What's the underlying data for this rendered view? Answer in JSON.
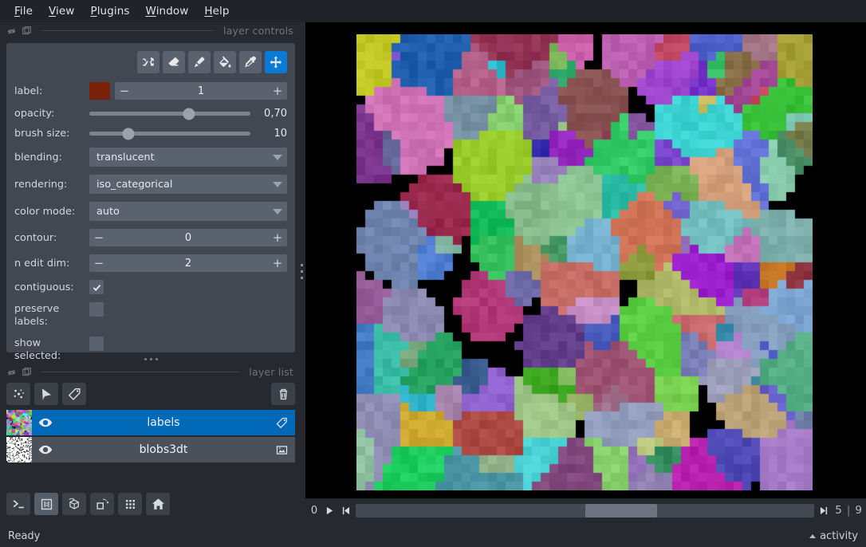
{
  "menu": {
    "items": [
      {
        "label": "File",
        "mnemonic": "F"
      },
      {
        "label": "View",
        "mnemonic": "V"
      },
      {
        "label": "Plugins",
        "mnemonic": "P"
      },
      {
        "label": "Window",
        "mnemonic": "W"
      },
      {
        "label": "Help",
        "mnemonic": "H"
      }
    ]
  },
  "layer_controls": {
    "dock_title": "layer controls",
    "tools": [
      {
        "name": "shuffle-colors-button",
        "icon": "shuffle-icon",
        "active": false
      },
      {
        "name": "eraser-button",
        "icon": "eraser-icon",
        "active": false
      },
      {
        "name": "paint-brush-button",
        "icon": "paintbrush-icon",
        "active": false
      },
      {
        "name": "fill-bucket-button",
        "icon": "fill-bucket-icon",
        "active": false
      },
      {
        "name": "color-picker-button",
        "icon": "eyedropper-icon",
        "active": false
      },
      {
        "name": "pan-zoom-button",
        "icon": "pan-arrows-icon",
        "active": true
      }
    ],
    "rows": {
      "label": {
        "caption": "label:",
        "value": "1",
        "swatch_color": "#7a2208",
        "minus": "−",
        "plus": "+"
      },
      "opacity": {
        "caption": "opacity:",
        "value": "0,70",
        "fraction": 0.62
      },
      "brush_size": {
        "caption": "brush size:",
        "value": "10",
        "fraction": 0.245
      },
      "blending": {
        "caption": "blending:",
        "value": "translucent"
      },
      "rendering": {
        "caption": "rendering:",
        "value": "iso_categorical"
      },
      "color_mode": {
        "caption": "color mode:",
        "value": "auto"
      },
      "contour": {
        "caption": "contour:",
        "value": "0",
        "minus": "−",
        "plus": "+"
      },
      "n_edit_dim": {
        "caption": "n edit dim:",
        "value": "2",
        "minus": "−",
        "plus": "+"
      },
      "contiguous": {
        "caption": "contiguous:",
        "checked": true
      },
      "preserve_labels": {
        "caption": "preserve labels:",
        "checked": false
      },
      "show_selected": {
        "caption": "show selected:",
        "checked": false
      }
    }
  },
  "layer_list": {
    "dock_title": "layer list",
    "buttons": [
      {
        "name": "new-points-layer-button",
        "icon": "points-icon"
      },
      {
        "name": "new-shapes-layer-button",
        "icon": "shapes-icon"
      },
      {
        "name": "new-labels-layer-button",
        "icon": "labels-tag-icon"
      },
      {
        "name": "delete-layer-button",
        "icon": "trash-icon"
      }
    ],
    "layers": [
      {
        "name": "labels",
        "type_icon": "labels-tag-icon",
        "selected": true,
        "visible": true
      },
      {
        "name": "blobs3dt",
        "type_icon": "image-icon",
        "selected": false,
        "visible": true
      }
    ]
  },
  "viewer_buttons": [
    {
      "name": "console-button",
      "icon": "console-icon",
      "active": false
    },
    {
      "name": "ndisplay-toggle-button",
      "icon": "ndisplay-icon",
      "active": true
    },
    {
      "name": "roll-dimensions-button",
      "icon": "cube-roll-icon",
      "active": false
    },
    {
      "name": "transpose-dimensions-button",
      "icon": "transpose-icon",
      "active": false
    },
    {
      "name": "grid-view-button",
      "icon": "grid-icon",
      "active": false
    },
    {
      "name": "reset-view-button",
      "icon": "home-icon",
      "active": false
    }
  ],
  "dims_slider": {
    "axis_label": "0",
    "current": "5",
    "separator": "|",
    "max": "9",
    "fraction": 0.5,
    "play_icon": "play-icon",
    "prev_icon": "step-backward-icon",
    "next_icon": "step-forward-icon"
  },
  "status_bar": {
    "message": "Ready",
    "activity_label": "activity"
  },
  "canvas": {
    "label": "blobs-labels-canvas",
    "background_color": "#000000"
  }
}
